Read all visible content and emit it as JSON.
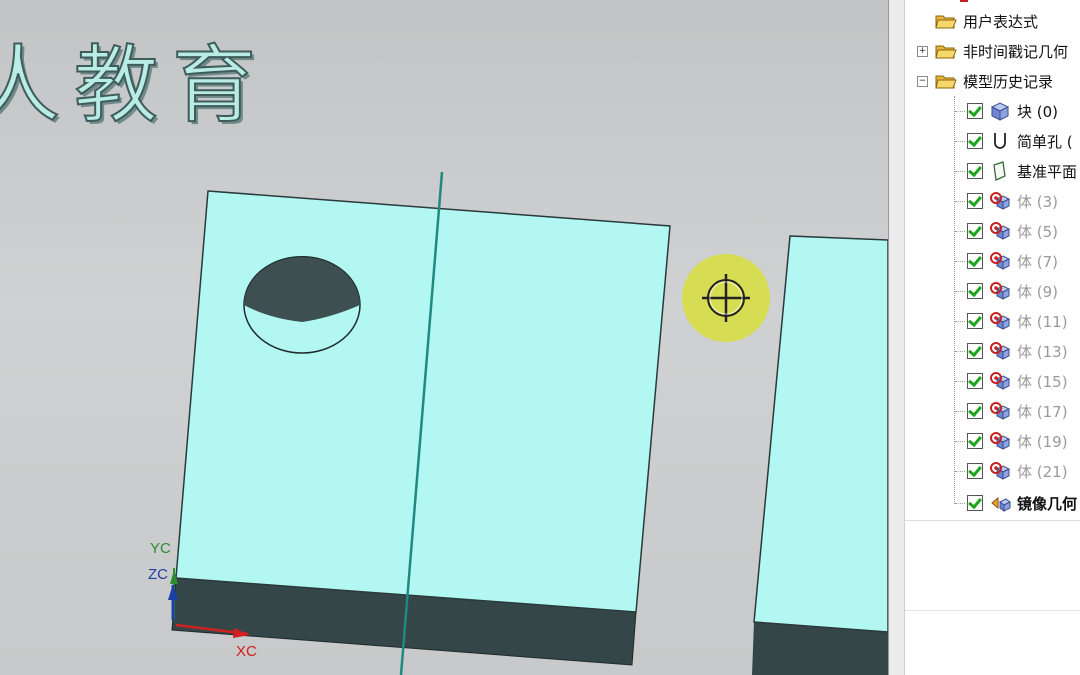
{
  "watermark": {
    "text": "人教育"
  },
  "axes": {
    "y_label": "YC",
    "z_label": "ZC",
    "x_label": "XC"
  },
  "part_navigator": {
    "items": [
      {
        "label": "用户表达式",
        "type": "folder",
        "expander": ""
      },
      {
        "label": "非时间戳记几何",
        "type": "folder",
        "expander": "+"
      },
      {
        "label": "模型历史记录",
        "type": "folder",
        "expander": "−"
      },
      {
        "label": "块 (0)",
        "type": "block-feature",
        "checked": true,
        "dimmed": false
      },
      {
        "label": "简单孔 (",
        "type": "hole-feature",
        "checked": true,
        "dimmed": false
      },
      {
        "label": "基准平面",
        "type": "datum-plane-feature",
        "checked": true,
        "dimmed": false
      },
      {
        "label": "体 (3)",
        "type": "body-feature",
        "checked": true,
        "dimmed": true
      },
      {
        "label": "体 (5)",
        "type": "body-feature",
        "checked": true,
        "dimmed": true
      },
      {
        "label": "体 (7)",
        "type": "body-feature",
        "checked": true,
        "dimmed": true
      },
      {
        "label": "体 (9)",
        "type": "body-feature",
        "checked": true,
        "dimmed": true
      },
      {
        "label": "体 (11)",
        "type": "body-feature",
        "checked": true,
        "dimmed": true
      },
      {
        "label": "体 (13)",
        "type": "body-feature",
        "checked": true,
        "dimmed": true
      },
      {
        "label": "体 (15)",
        "type": "body-feature",
        "checked": true,
        "dimmed": true
      },
      {
        "label": "体 (17)",
        "type": "body-feature",
        "checked": true,
        "dimmed": true
      },
      {
        "label": "体 (19)",
        "type": "body-feature",
        "checked": true,
        "dimmed": true
      },
      {
        "label": "体 (21)",
        "type": "body-feature",
        "checked": true,
        "dimmed": true
      },
      {
        "label": "镜像几何",
        "type": "mirror-geometry-feature",
        "checked": true,
        "dimmed": false,
        "bold": true
      }
    ]
  },
  "colors": {
    "part_face": "#b3f7f3",
    "part_side": "#354648",
    "datum_line": "#1f8a80",
    "cursor_highlight": "#d8df3c",
    "check_green": "#1ea51e"
  }
}
